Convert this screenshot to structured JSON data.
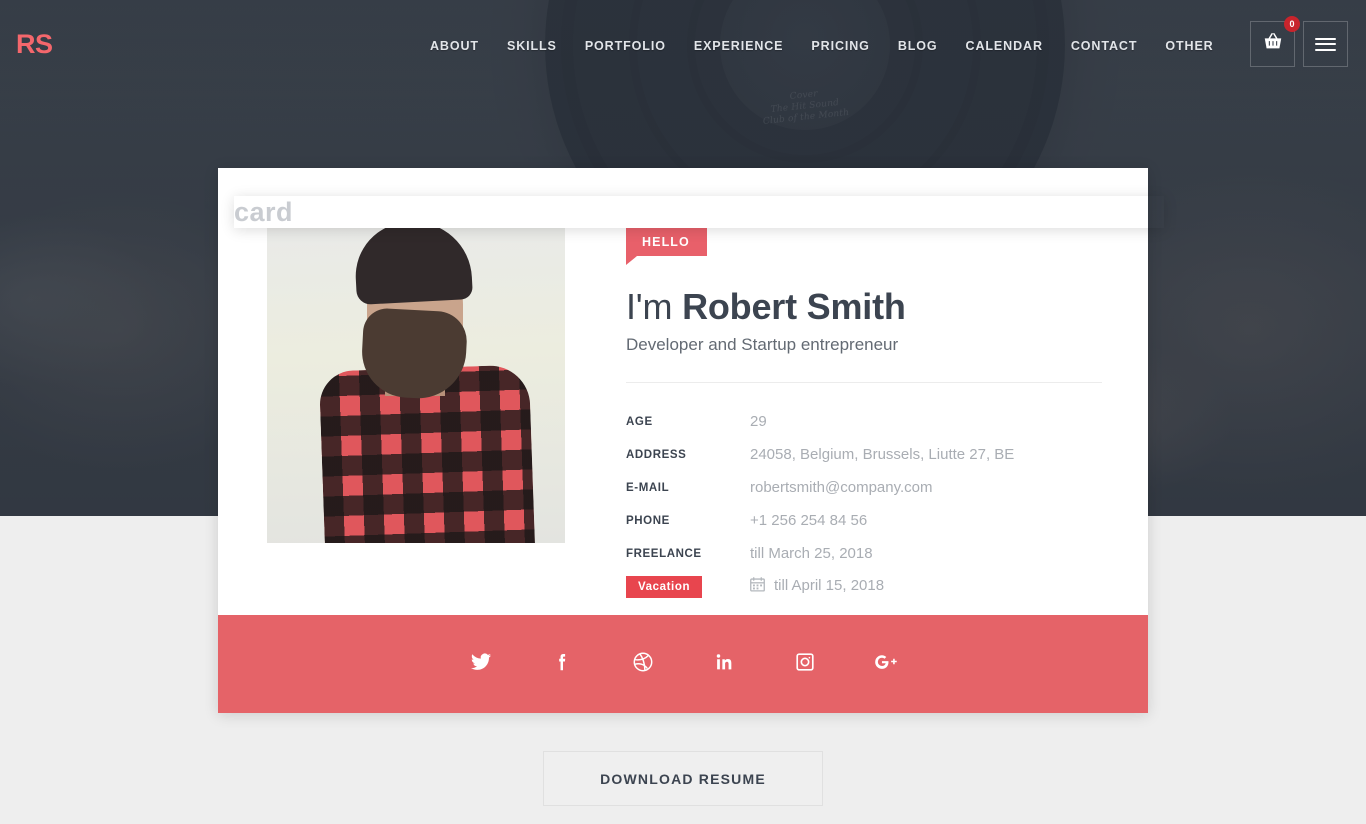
{
  "header": {
    "logo": {
      "primary": "RS",
      "secondary": "card"
    },
    "nav": [
      {
        "label": "ABOUT"
      },
      {
        "label": "SKILLS"
      },
      {
        "label": "PORTFOLIO"
      },
      {
        "label": "EXPERIENCE"
      },
      {
        "label": "PRICING"
      },
      {
        "label": "BLOG"
      },
      {
        "label": "CALENDAR"
      },
      {
        "label": "CONTACT"
      },
      {
        "label": "OTHER"
      }
    ],
    "cart": {
      "icon": "basket-icon",
      "badge_count": "0"
    },
    "menu": {
      "icon": "hamburger-menu-icon"
    }
  },
  "card": {
    "portrait_alt": "portrait-photo",
    "hello_label": "HELLO",
    "greeting_prefix": "I'm ",
    "name": "Robert Smith",
    "subtitle": "Developer and Startup entrepreneur",
    "info": [
      {
        "label": "AGE",
        "value": "29"
      },
      {
        "label": "ADDRESS",
        "value": "24058, Belgium, Brussels, Liutte 27, BE"
      },
      {
        "label": "E-MAIL",
        "value": "robertsmith@company.com"
      },
      {
        "label": "PHONE",
        "value": "+1 256 254 84 56"
      },
      {
        "label": "FREELANCE",
        "value": "till March 25, 2018"
      }
    ],
    "vacation": {
      "badge": "Vacation",
      "icon": "calendar-icon",
      "value": "till April 15, 2018"
    },
    "social": [
      {
        "name": "twitter",
        "label": "Twitter"
      },
      {
        "name": "facebook",
        "label": "Facebook"
      },
      {
        "name": "dribbble",
        "label": "Dribbble"
      },
      {
        "name": "linkedin",
        "label": "LinkedIn"
      },
      {
        "name": "instagram",
        "label": "Instagram"
      },
      {
        "name": "googleplus",
        "label": "Google Plus"
      }
    ]
  },
  "actions": {
    "download_label": "DOWNLOAD RESUME"
  },
  "colors": {
    "accent": "#e56368",
    "accent_dark": "#e8454e",
    "header_bg": "#2d343e",
    "page_bg": "#eeeeee",
    "text_dark": "#3c4450",
    "text_muted": "#a9adb3"
  },
  "background": {
    "vinyl_script": "Cover\nThe Hit Sound\nClub of the Month"
  }
}
